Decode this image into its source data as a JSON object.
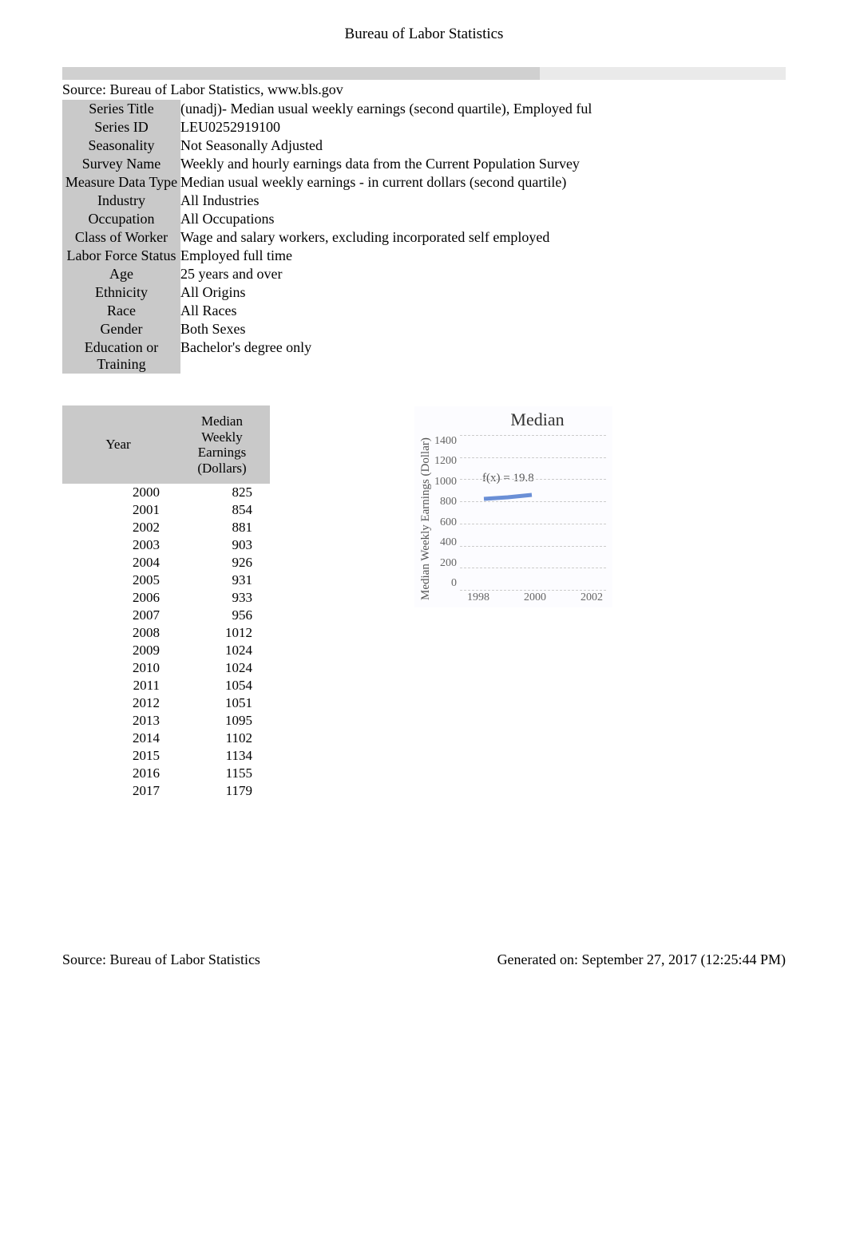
{
  "page_title": "Bureau of Labor Statistics",
  "source_line": "Source: Bureau of Labor Statistics, www.bls.gov",
  "meta": [
    {
      "label": "Series Title",
      "value": "(unadj)- Median usual weekly earnings (second quartile), Employed ful"
    },
    {
      "label": "Series ID",
      "value": "LEU0252919100"
    },
    {
      "label": "Seasonality",
      "value": "Not Seasonally Adjusted"
    },
    {
      "label": "Survey Name",
      "value": "Weekly and hourly earnings data from the Current Population Survey"
    },
    {
      "label": "Measure Data Type",
      "value": "Median usual weekly earnings - in current dollars (second quartile)"
    },
    {
      "label": "Industry",
      "value": "All Industries"
    },
    {
      "label": "Occupation",
      "value": "All Occupations"
    },
    {
      "label": "Class of Worker",
      "value": "Wage and salary workers, excluding incorporated self employed"
    },
    {
      "label": "Labor Force Status",
      "value": "Employed full time"
    },
    {
      "label": "Age",
      "value": "25 years and over"
    },
    {
      "label": "Ethnicity",
      "value": "All Origins"
    },
    {
      "label": "Race",
      "value": "All Races"
    },
    {
      "label": "Gender",
      "value": "Both Sexes"
    },
    {
      "label": "Education or Training",
      "value": "Bachelor's degree only"
    }
  ],
  "data_table": {
    "head_year": "Year",
    "head_value": "Median\nWeekly\nEarnings\n(Dollars)",
    "rows": [
      {
        "year": "2000",
        "value": "825"
      },
      {
        "year": "2001",
        "value": "854"
      },
      {
        "year": "2002",
        "value": "881"
      },
      {
        "year": "2003",
        "value": "903"
      },
      {
        "year": "2004",
        "value": "926"
      },
      {
        "year": "2005",
        "value": "931"
      },
      {
        "year": "2006",
        "value": "933"
      },
      {
        "year": "2007",
        "value": "956"
      },
      {
        "year": "2008",
        "value": "1012"
      },
      {
        "year": "2009",
        "value": "1024"
      },
      {
        "year": "2010",
        "value": "1024"
      },
      {
        "year": "2011",
        "value": "1054"
      },
      {
        "year": "2012",
        "value": "1051"
      },
      {
        "year": "2013",
        "value": "1095"
      },
      {
        "year": "2014",
        "value": "1102"
      },
      {
        "year": "2015",
        "value": "1134"
      },
      {
        "year": "2016",
        "value": "1155"
      },
      {
        "year": "2017",
        "value": "1179"
      }
    ]
  },
  "chart_data": {
    "type": "line",
    "title": "Median",
    "ylabel": "Median Weekly Earnings (Dollar)",
    "xlabel": "",
    "ylim": [
      0,
      1400
    ],
    "yticks": [
      "1400",
      "1200",
      "1000",
      "800",
      "600",
      "400",
      "200",
      "0"
    ],
    "xticks": [
      "1998",
      "2000",
      "2002"
    ],
    "fx_label": "f(x) = 19.8",
    "x": [
      2000,
      2001,
      2002
    ],
    "values": [
      825,
      854,
      881
    ]
  },
  "footer": {
    "left": "Source: Bureau of Labor Statistics",
    "right": "Generated on: September 27, 2017 (12:25:44 PM)"
  }
}
